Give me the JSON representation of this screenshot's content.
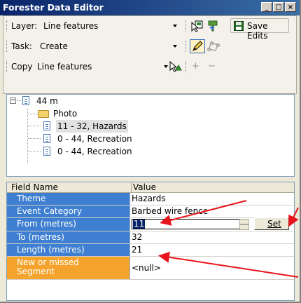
{
  "window": {
    "title": "Forester Data Editor",
    "minimize": "_",
    "maximize": "□",
    "close": "×"
  },
  "toolbar": {
    "layer_label": "Layer:",
    "layer_value": "Line features",
    "task_label": "Task:",
    "task_value": "Create",
    "copy_label": "Copy",
    "copy_value": "Line features",
    "save_label": "Save Edits",
    "plus": "+",
    "minus": "−"
  },
  "tree": {
    "root": {
      "label": "44 m",
      "expander": "−"
    },
    "children": [
      {
        "label": "Photo",
        "icon": "folder-icon"
      },
      {
        "label": "11 - 32, Hazards",
        "icon": "document-icon",
        "selected": true
      },
      {
        "label": "0 - 44, Recreation",
        "icon": "document-icon"
      },
      {
        "label": "0 - 44, Recreation",
        "icon": "document-icon"
      }
    ]
  },
  "grid": {
    "col_field": "Field Name",
    "col_value": "Value",
    "rows": [
      {
        "name": "Theme",
        "value": "Hazards"
      },
      {
        "name": "Event Category",
        "value": "Barbed wire fence"
      },
      {
        "name": "From (metres)",
        "value": "11"
      },
      {
        "name": "To (metres)",
        "value": "32"
      },
      {
        "name": "Length (metres)",
        "value": "21"
      },
      {
        "name": "New or missed Segment",
        "value": "<null>"
      }
    ],
    "set_label": "Set"
  },
  "colors": {
    "title_bar": "#0a246a",
    "field_name_bg": "#3e7fd1",
    "highlight_field_bg": "#f4a42c",
    "annotation_arrow": "#e8141b"
  }
}
